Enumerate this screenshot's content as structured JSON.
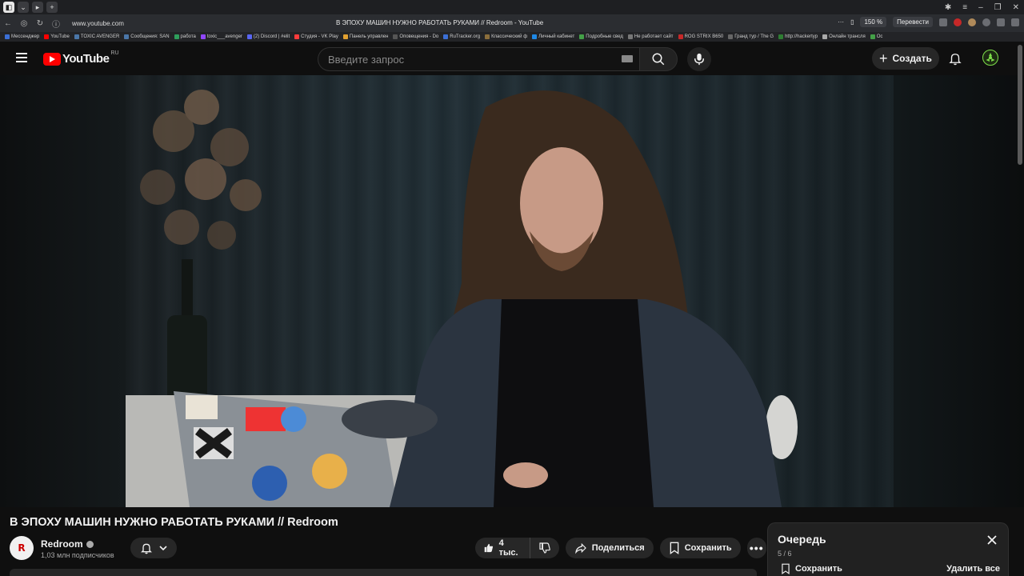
{
  "browser": {
    "url": "www.youtube.com",
    "page_title": "В ЭПОХУ МАШИН НУЖНО РАБОТАТЬ РУКАМИ // Redroom - YouTube",
    "zoom": "150 %",
    "translate_label": "Перевести",
    "bookmarks": [
      {
        "label": "Мессенджер",
        "color": "#3b6fd6"
      },
      {
        "label": "YouTube",
        "color": "#ff0000"
      },
      {
        "label": "TOXIC AVENGER",
        "color": "#4a76a8"
      },
      {
        "label": "Сообщения: SAN",
        "color": "#4a76a8"
      },
      {
        "label": "работа",
        "color": "#2e9e5b"
      },
      {
        "label": "toxic___avenger",
        "color": "#9146ff"
      },
      {
        "label": "(2) Discord | #elit",
        "color": "#5865f2"
      },
      {
        "label": "Студия - VK Play",
        "color": "#ff3b3b"
      },
      {
        "label": "Панель управлен",
        "color": "#e0a030"
      },
      {
        "label": "Оповещения - Do",
        "color": "#555555"
      },
      {
        "label": "RuTracker.org",
        "color": "#3b6fd6"
      },
      {
        "label": "Классический ф",
        "color": "#8a6d3b"
      },
      {
        "label": "Личный кабинет",
        "color": "#1e88e5"
      },
      {
        "label": "Подробные свед",
        "color": "#43a047"
      },
      {
        "label": "Не работает сайт",
        "color": "#777777"
      },
      {
        "label": "ROG STRIX B650",
        "color": "#c62828"
      },
      {
        "label": "Гранд тур / The G",
        "color": "#666666"
      },
      {
        "label": "http://hackertyp",
        "color": "#2e7d32"
      },
      {
        "label": "Онлайн трансля",
        "color": "#aaaaaa"
      },
      {
        "label": "Ос",
        "color": "#43a047"
      }
    ]
  },
  "youtube": {
    "logo_text": "YouTube",
    "region": "RU",
    "search_placeholder": "Введите запрос",
    "create_label": "Создать"
  },
  "video": {
    "title": "В ЭПОХУ МАШИН НУЖНО РАБОТАТЬ РУКАМИ // Redroom",
    "channel_name": "Redroom",
    "channel_avatar_text": "R",
    "subscribers": "1,03 млн подписчиков",
    "likes": "4 тыс.",
    "share_label": "Поделиться",
    "save_label": "Сохранить"
  },
  "queue": {
    "title": "Очередь",
    "position": "5 / 6",
    "save_label": "Сохранить",
    "clear_label": "Удалить все"
  },
  "colors": {
    "brand_red": "#ff0000",
    "background": "#0f0f0f",
    "button_bg": "#272727"
  }
}
